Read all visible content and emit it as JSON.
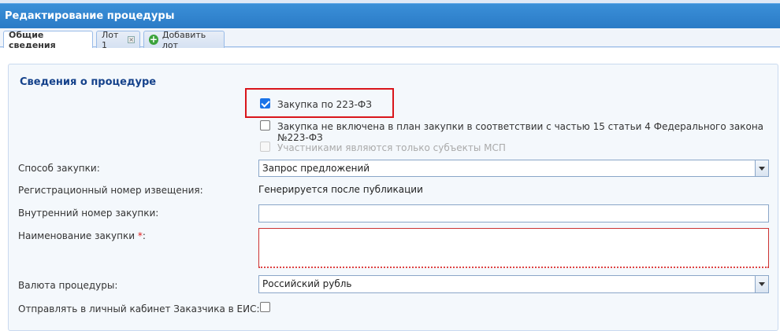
{
  "window": {
    "title": "Редактирование процедуры"
  },
  "tabs": [
    {
      "label": "Общие сведения"
    },
    {
      "label": "Лот 1"
    },
    {
      "label": "Добавить лот"
    }
  ],
  "section": {
    "title": "Сведения о процедуре"
  },
  "checkboxes": [
    {
      "label": "Закупка по 223-ФЗ",
      "checked": true
    },
    {
      "label": "Закупка не включена в план закупки в соответствии с частью 15 статьи 4 Федерального закона №223-ФЗ",
      "checked": false
    },
    {
      "label": "Участниками являются только субъекты МСП",
      "checked": false,
      "disabled": true
    }
  ],
  "form": {
    "method_label": "Способ закупки:",
    "method_value": "Запрос предложений",
    "regnum_label": "Регистрационный номер извещения:",
    "regnum_value": "Генерируется после публикации",
    "internal_label": "Внутренний номер закупки:",
    "internal_value": "",
    "name_label": "Наименование закупки",
    "name_required_mark": "*",
    "name_colon": ":",
    "name_value": "",
    "currency_label": "Валюта процедуры:",
    "currency_value": "Российский рубль",
    "send_label": "Отправлять в личный кабинет Заказчика в ЕИС:",
    "send_checked": false
  },
  "colors": {
    "title_bar": "#2b7bc6",
    "highlight": "#d9151b",
    "section_title": "#15428b"
  }
}
